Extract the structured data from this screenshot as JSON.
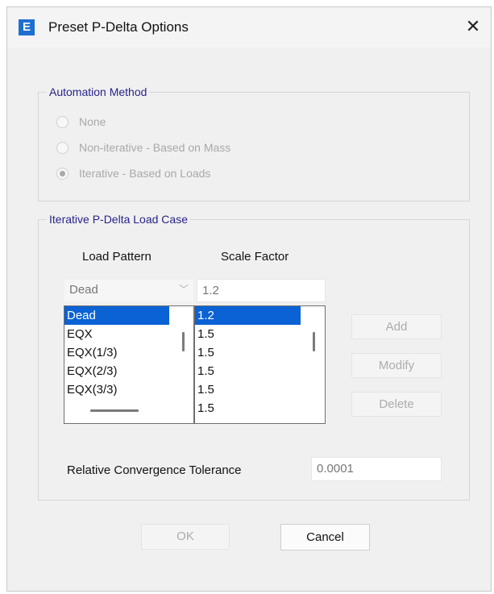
{
  "window": {
    "app_icon": "E",
    "title": "Preset P-Delta Options",
    "close_glyph": "✕"
  },
  "automation": {
    "group_label": "Automation Method",
    "options": [
      {
        "label": "None",
        "selected": false
      },
      {
        "label": "Non-iterative - Based on Mass",
        "selected": false
      },
      {
        "label": "Iterative - Based on Loads",
        "selected": true
      }
    ],
    "disabled": true
  },
  "load_case": {
    "group_label": "Iterative P-Delta Load Case",
    "headers": {
      "load_pattern": "Load Pattern",
      "scale_factor": "Scale Factor"
    },
    "current": {
      "load_pattern": "Dead",
      "scale_factor": "1.2"
    },
    "load_patterns": [
      "Dead",
      "EQX",
      "EQX(1/3)",
      "EQX(2/3)",
      "EQX(3/3)"
    ],
    "scale_factors": [
      "1.2",
      "1.5",
      "1.5",
      "1.5",
      "1.5",
      "1.5"
    ],
    "selected_index": 0,
    "buttons": {
      "add": "Add",
      "modify": "Modify",
      "delete": "Delete"
    },
    "tolerance_label": "Relative Convergence Tolerance",
    "tolerance_value": "0.0001"
  },
  "footer": {
    "ok": "OK",
    "cancel": "Cancel"
  },
  "colors": {
    "accent": "#0a62d4",
    "group_label": "#27248a",
    "app_icon_bg": "#1f6fd1"
  }
}
